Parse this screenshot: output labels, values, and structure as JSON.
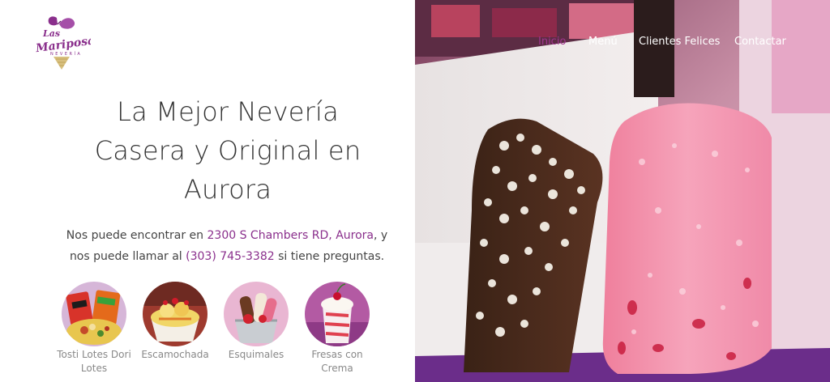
{
  "brand": {
    "name_line1": "Las",
    "name_line2": "Mariposas",
    "name_line3": "NEVERÍA",
    "colors": {
      "primary": "#8a2f8c",
      "accent": "#c7b47a"
    }
  },
  "nav": {
    "items": [
      {
        "label": "Inicio",
        "active": true
      },
      {
        "label": "Menú",
        "active": false
      },
      {
        "label": "Clientes Felices",
        "active": false
      },
      {
        "label": "Contactar",
        "active": false
      }
    ]
  },
  "hero": {
    "title_line1": "La Mejor Nevería",
    "title_line2": "Casera y Original en",
    "title_line3": "Aurora"
  },
  "intro": {
    "text1": "Nos puede encontrar en ",
    "address": "2300 S Chambers RD, Aurora",
    "text2": ", y nos puede llamar al ",
    "phone": "(303) 745-3382",
    "text3": " si tiene preguntas."
  },
  "products": [
    {
      "label": "Tosti Lotes Dori Lotes",
      "icon": "tosti-lotes-photo"
    },
    {
      "label": "Escamochada",
      "icon": "escamochada-photo"
    },
    {
      "label": "Esquimales",
      "icon": "esquimales-photo"
    },
    {
      "label": "Fresas con Crema",
      "icon": "fresas-con-crema-photo"
    }
  ]
}
